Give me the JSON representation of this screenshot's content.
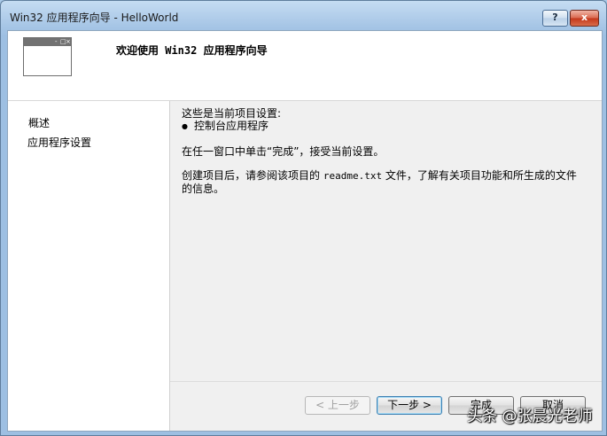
{
  "window": {
    "title": "Win32 应用程序向导 - HelloWorld",
    "help_label": "?",
    "close_label": "x"
  },
  "header": {
    "title": "欢迎使用 Win32 应用程序向导"
  },
  "nav": {
    "items": [
      {
        "label": "概述"
      },
      {
        "label": "应用程序设置"
      }
    ]
  },
  "content": {
    "intro": "这些是当前项目设置:",
    "bullet": "控制台应用程序",
    "finish_hint": "在任一窗口中单击“完成”，接受当前设置。",
    "info_prefix": "创建项目后，请参阅该项目的",
    "info_file": "readme.txt",
    "info_suffix": "文件，了解有关项目功能和所生成的文件",
    "info_line2": "的信息。"
  },
  "buttons": {
    "prev": "< 上一步",
    "next": "下一步 >",
    "finish": "完成",
    "cancel": "取消"
  },
  "watermark": "头条 @张晨光老师"
}
